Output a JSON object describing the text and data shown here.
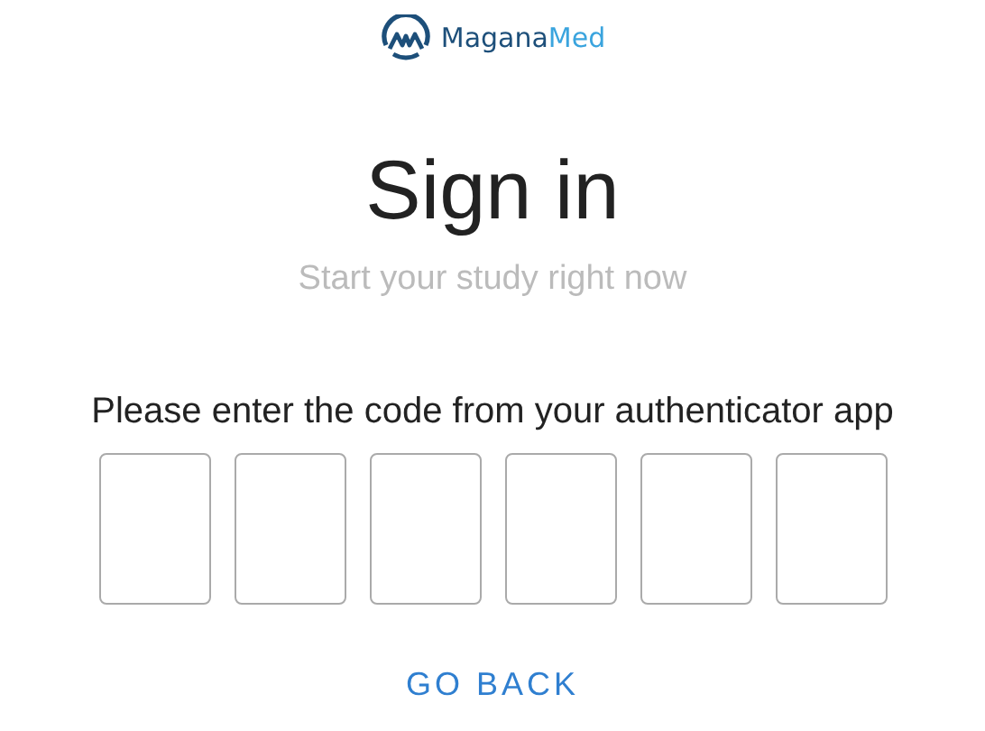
{
  "logo": {
    "name_main": "Magana",
    "name_accent": "Med"
  },
  "title": "Sign in",
  "subtitle": "Start your study right now",
  "prompt": "Please enter the code from your authenticator app",
  "code_fields": [
    {
      "focused": false
    },
    {
      "focused": false
    },
    {
      "focused": false
    },
    {
      "focused": false
    },
    {
      "focused": false
    },
    {
      "focused": false
    }
  ],
  "back_button": "GO BACK"
}
